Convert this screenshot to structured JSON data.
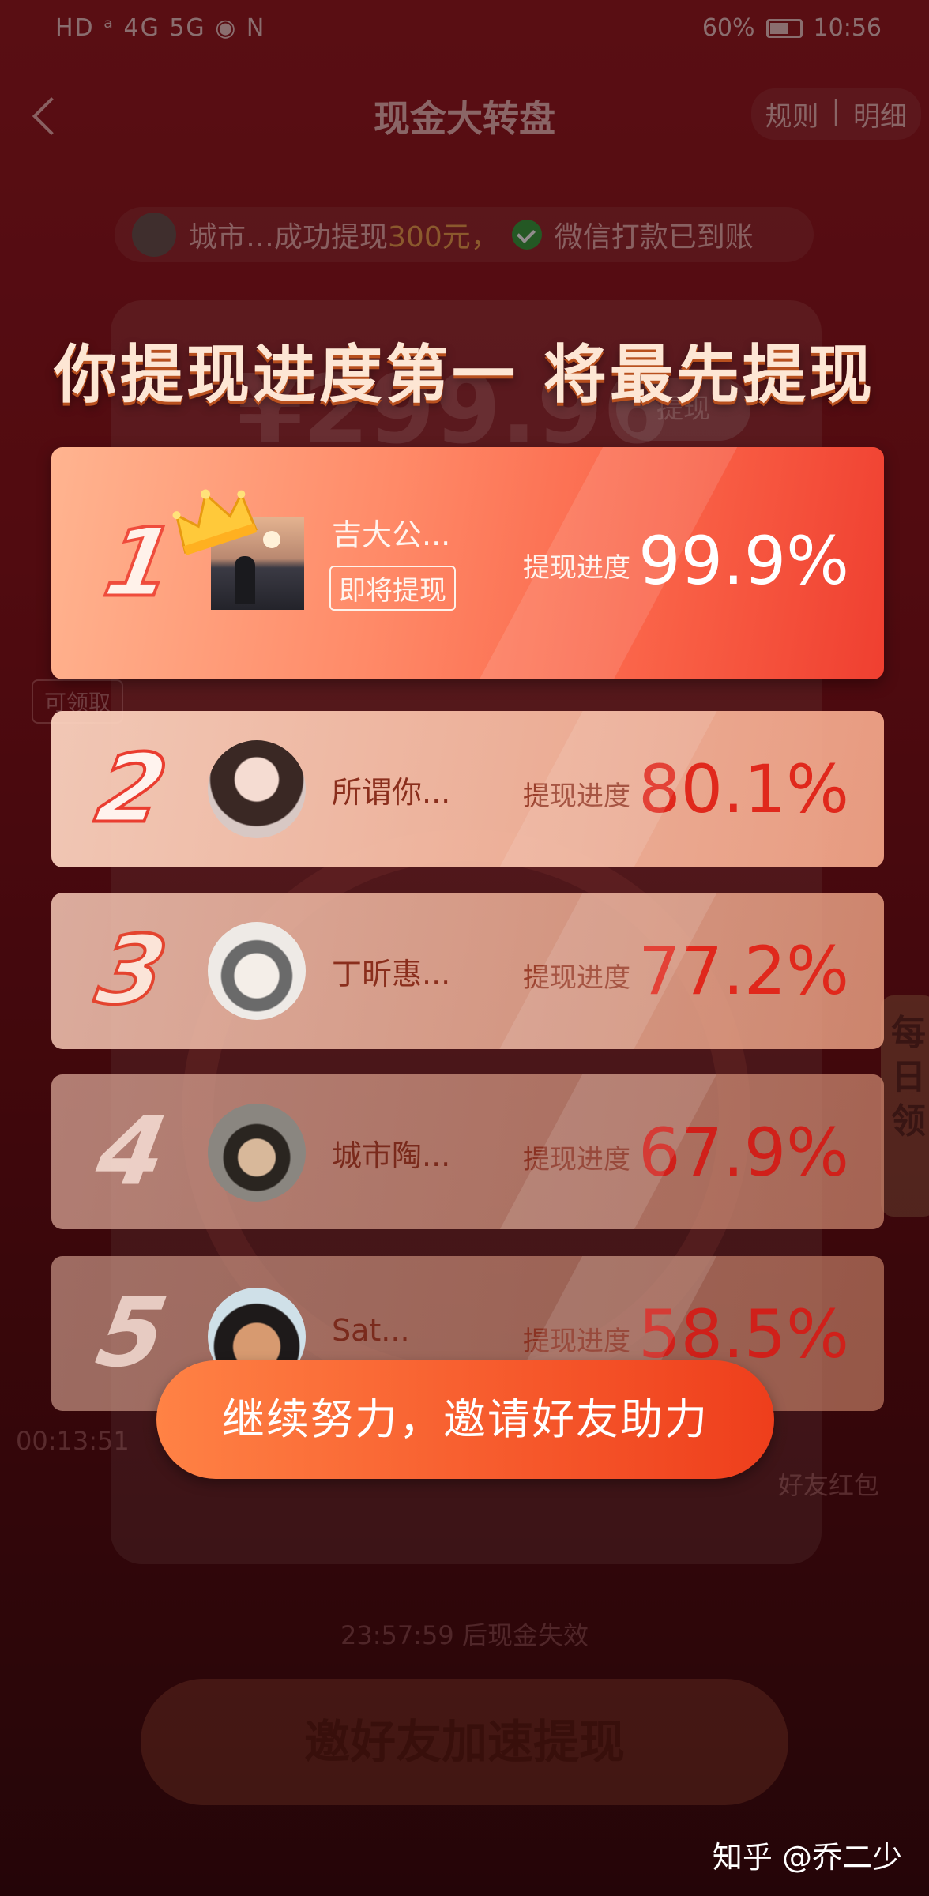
{
  "status_bar": {
    "left": "HD ᵃ 4G 5G ◉ N",
    "battery": "60%",
    "time": "10:56"
  },
  "header": {
    "title": "现金大转盘",
    "rules": "规则",
    "separator": "|",
    "details": "明细"
  },
  "notice": {
    "prefix": "城市…成功提现",
    "amount": "300元，",
    "suffix": "微信打款已到账"
  },
  "background": {
    "amount": "¥299.96",
    "withdraw_button": "提现",
    "claimable": "可领取",
    "daily": "每日领",
    "countdown": "00:13:51",
    "friend_red_packet": "好友红包",
    "expire_text": "23:57:59 后现金失效",
    "invite_button": "邀好友加速提现"
  },
  "modal": {
    "title": "你提现进度第一 将最先提现",
    "progress_label": "提现进度",
    "ranking": [
      {
        "rank": "1",
        "name": "吉大公...",
        "badge": "即将提现",
        "progress": "99.9%",
        "avatar_icon": "avatar-landscape-icon"
      },
      {
        "rank": "2",
        "name": "所谓你...",
        "progress": "80.1%",
        "avatar_icon": "avatar-girl-icon"
      },
      {
        "rank": "3",
        "name": "丁昕惠...",
        "progress": "77.2%",
        "avatar_icon": "avatar-sketch-icon"
      },
      {
        "rank": "4",
        "name": "城市陶...",
        "progress": "67.9%",
        "avatar_icon": "avatar-man-icon"
      },
      {
        "rank": "5",
        "name": "Sat...",
        "progress": "58.5%",
        "avatar_icon": "avatar-cartoon-icon"
      }
    ],
    "cta_button": "继续努力，邀请好友助力"
  },
  "watermark": "知乎 @乔二少",
  "colors": {
    "accent": "#f6582b",
    "first_card": "#f95f45",
    "progress_red": "#e0281c"
  }
}
